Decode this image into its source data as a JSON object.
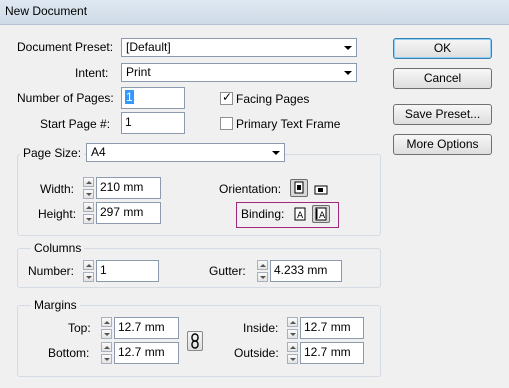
{
  "window": {
    "title": "New Document"
  },
  "preset": {
    "label": "Document Preset:",
    "value": "[Default]"
  },
  "intent": {
    "label": "Intent:",
    "value": "Print"
  },
  "pages": {
    "number_label": "Number of Pages:",
    "number_value": "1",
    "start_label": "Start Page #:",
    "start_value": "1",
    "facing_label": "Facing Pages",
    "facing_checked": true,
    "primary_label": "Primary Text Frame",
    "primary_checked": false
  },
  "buttons": {
    "ok": "OK",
    "cancel": "Cancel",
    "save_preset": "Save Preset...",
    "more_options": "More Options"
  },
  "page_size": {
    "label": "Page Size:",
    "value": "A4",
    "width_label": "Width:",
    "width_value": "210 mm",
    "height_label": "Height:",
    "height_value": "297 mm",
    "orientation_label": "Orientation:",
    "binding_label": "Binding:",
    "orientation_selected": "portrait",
    "binding_selected": "right-to-left"
  },
  "columns": {
    "title": "Columns",
    "number_label": "Number:",
    "number_value": "1",
    "gutter_label": "Gutter:",
    "gutter_value": "4.233 mm"
  },
  "margins": {
    "title": "Margins",
    "top_label": "Top:",
    "top_value": "12.7 mm",
    "bottom_label": "Bottom:",
    "bottom_value": "12.7 mm",
    "inside_label": "Inside:",
    "inside_value": "12.7 mm",
    "outside_label": "Outside:",
    "outside_value": "12.7 mm"
  },
  "colors": {
    "binding_highlight": "#a0287a",
    "selection": "#3399ff"
  }
}
